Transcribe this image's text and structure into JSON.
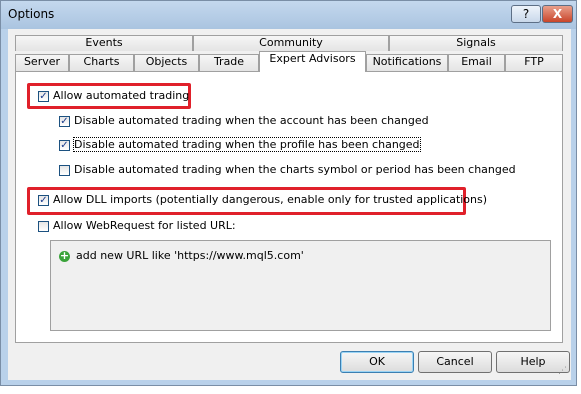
{
  "window": {
    "title": "Options",
    "help_glyph": "?",
    "close_glyph": "X"
  },
  "tabs_row1": [
    "Events",
    "Community",
    "Signals"
  ],
  "tabs_row2": [
    "Server",
    "Charts",
    "Objects",
    "Trade",
    "Expert Advisors",
    "Notifications",
    "Email",
    "FTP"
  ],
  "active_tab": "Expert Advisors",
  "options": {
    "allow_auto_trading": {
      "label": "Allow automated trading",
      "checked": true
    },
    "disable_account": {
      "label": "Disable automated trading when the account has been changed",
      "checked": true
    },
    "disable_profile": {
      "label": "Disable automated trading when the profile has been changed",
      "checked": true
    },
    "disable_symbol": {
      "label": "Disable automated trading when the charts symbol or period has been changed",
      "checked": false
    },
    "allow_dll": {
      "label": "Allow DLL imports (potentially dangerous, enable only for trusted applications)",
      "checked": true
    },
    "allow_webrequest": {
      "label": "Allow WebRequest for listed URL:",
      "checked": false
    }
  },
  "url_list": {
    "add_label": "add new URL like 'https://www.mql5.com'",
    "add_icon": "plus-circle-icon"
  },
  "buttons": {
    "ok": "OK",
    "cancel": "Cancel",
    "help": "Help"
  },
  "colors": {
    "highlight": "#e0202a",
    "titlebar": "#b9d1ea"
  }
}
